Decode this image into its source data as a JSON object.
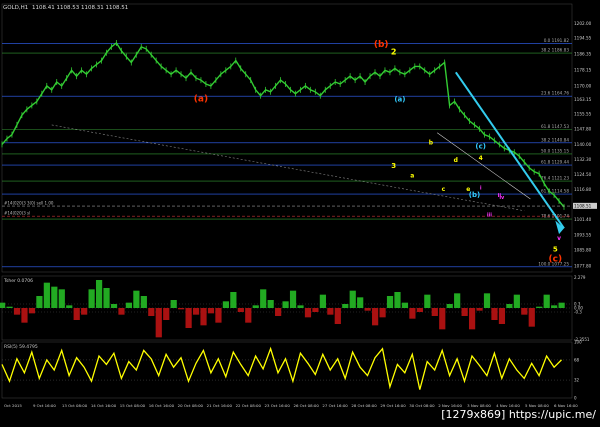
{
  "header": {
    "symbol": "GOLD,H1",
    "ohlc": "1108.41 1108.53 1108.31 1108.51"
  },
  "watermark": "[1279x869] https://upic.me/",
  "colors": {
    "background": "#000000",
    "candles": "#33cc33",
    "elliott_red": "#ff3300",
    "elliott_yellow": "#ffff00",
    "elliott_cyan": "#33ccff",
    "elliott_magenta": "#ff33ff",
    "fib_blue": "#3366ff",
    "fib_green": "#339933",
    "trend_arrow": "#33ccee",
    "osc_line": "#ffff00"
  },
  "chart_data": [
    {
      "type": "line",
      "title": "GOLD,H1 1108.41 1108.53 1108.31 1108.51",
      "ylim": [
        1074.6,
        1212.0
      ],
      "yticks": [
        1202.0,
        1194.55,
        1186.35,
        1178.15,
        1170.0,
        1163.15,
        1155.55,
        1147.8,
        1140.0,
        1132.3,
        1124.5,
        1116.8,
        1109.0,
        1101.4,
        1093.55,
        1085.8,
        1077.8
      ],
      "current_price": "1108.51",
      "x_labels": [
        "Oct 2015",
        "9 Oct 16:00",
        "13 Oct 08:00",
        "14 Oct 16:00",
        "15 Oct 08:00",
        "16 Oct 16:00",
        "20 Oct 08:00",
        "21 Oct 16:00",
        "22 Oct 08:00",
        "23 Oct 16:00",
        "26 Oct 08:00",
        "27 Oct 16:00",
        "28 Oct 08:00",
        "29 Oct 16:00",
        "30 Oct 08:00",
        "2 Nov 16:00",
        "3 Nov 08:00",
        "4 Nov 16:00",
        "5 Nov 08:00",
        "6 Nov 16:00"
      ],
      "series": [
        {
          "name": "",
          "x": [
            0,
            4,
            8,
            12,
            16,
            20,
            24,
            28,
            32,
            36,
            40,
            44,
            48,
            52,
            56,
            60,
            64,
            68,
            72,
            76,
            80,
            84,
            88,
            92,
            96,
            100,
            104,
            108,
            112,
            116,
            120,
            124,
            128,
            132,
            136,
            140,
            144,
            148,
            152,
            156,
            160,
            164,
            168,
            172,
            176,
            180,
            184,
            188,
            192,
            196,
            200,
            204,
            208,
            212,
            216,
            220,
            224,
            228,
            232,
            236,
            240,
            244,
            248,
            252,
            256,
            260,
            264,
            268,
            272,
            276,
            280,
            284,
            288,
            292,
            296,
            300,
            304,
            308,
            312,
            316,
            320,
            324,
            328,
            332,
            336,
            340,
            344,
            348,
            352,
            356,
            360,
            364,
            368,
            372,
            376,
            380,
            384,
            388,
            392,
            396,
            400,
            404,
            408,
            412,
            416,
            420,
            424,
            428,
            432,
            436,
            440,
            444,
            448,
            452
          ],
          "y": [
            1140,
            1143,
            1145,
            1150,
            1155,
            1158,
            1160,
            1162,
            1166,
            1170,
            1168,
            1172,
            1170,
            1174,
            1178,
            1175,
            1178,
            1176,
            1179,
            1181,
            1183,
            1187,
            1190,
            1192,
            1188,
            1185,
            1182,
            1186,
            1190,
            1189,
            1186,
            1183,
            1180,
            1178,
            1176,
            1178,
            1176,
            1174,
            1177,
            1174,
            1173,
            1171,
            1170,
            1173,
            1176,
            1178,
            1180,
            1183,
            1179,
            1176,
            1173,
            1168,
            1165,
            1168,
            1167,
            1170,
            1173,
            1171,
            1168,
            1166,
            1168,
            1170,
            1168,
            1167,
            1165,
            1168,
            1170,
            1172,
            1171,
            1173,
            1175,
            1173,
            1175,
            1172,
            1175,
            1177,
            1175,
            1178,
            1177,
            1179,
            1177,
            1176,
            1178,
            1180,
            1180,
            1178,
            1176,
            1178,
            1180,
            1182,
            1160,
            1162,
            1158,
            1155,
            1152,
            1150,
            1148,
            1145,
            1144,
            1142,
            1140,
            1138,
            1137,
            1136,
            1134,
            1131,
            1128,
            1126,
            1125,
            1120,
            1116,
            1114,
            1111,
            1108
          ]
        }
      ],
      "fib_levels": [
        {
          "label": "0.0 1191.82",
          "y": 1191.82
        },
        {
          "label": "38.2 1186.83",
          "y": 1186.83
        },
        {
          "label": "23.6 1164.76",
          "y": 1164.76
        },
        {
          "label": "61.8 1147.53",
          "y": 1147.53
        },
        {
          "label": "38.2 1140.84",
          "y": 1140.84
        },
        {
          "label": "50.0 1135.15",
          "y": 1135.15
        },
        {
          "label": "61.8 1129.44",
          "y": 1129.44
        },
        {
          "label": "76.4 1121.23",
          "y": 1121.23
        },
        {
          "label": "61.8 1114.58",
          "y": 1114.58
        },
        {
          "label": "78.6 1101.74",
          "y": 1101.74
        },
        {
          "label": "100.0 1077.25",
          "y": 1077.25
        }
      ],
      "hline_labels": [
        "#14(020)3 3(0) sell 1.00",
        "#14(020)3 sl"
      ],
      "wave_labels": [
        {
          "text": "(a)",
          "color": "red"
        },
        {
          "text": "(b)",
          "color": "red"
        },
        {
          "text": "(c)",
          "color": "red"
        },
        {
          "text": "2",
          "color": "yellow"
        },
        {
          "text": "3",
          "color": "yellow"
        },
        {
          "text": "4",
          "color": "yellow"
        },
        {
          "text": "5",
          "color": "yellow"
        },
        {
          "text": "(a)",
          "color": "cyan"
        },
        {
          "text": "(b)",
          "color": "cyan"
        },
        {
          "text": "(c)",
          "color": "cyan"
        },
        {
          "text": "a",
          "color": "yellow"
        },
        {
          "text": "b",
          "color": "yellow"
        },
        {
          "text": "c",
          "color": "yellow"
        },
        {
          "text": "d",
          "color": "yellow"
        },
        {
          "text": "e",
          "color": "yellow"
        },
        {
          "text": "i",
          "color": "magenta"
        },
        {
          "text": "ii",
          "color": "magenta"
        },
        {
          "text": "iii",
          "color": "magenta"
        },
        {
          "text": "iv",
          "color": "magenta"
        },
        {
          "text": "v",
          "color": "magenta"
        }
      ]
    },
    {
      "type": "area",
      "title": "Tsher 0.0706",
      "ylim": [
        -2.4,
        2.4
      ],
      "yticks": [
        "2.279",
        "0.3",
        "0.00",
        "-0.3",
        "-2.3551"
      ],
      "grid": true,
      "series": [
        {
          "name": "",
          "x": [
            0,
            6,
            12,
            18,
            24,
            30,
            36,
            42,
            48,
            54,
            60,
            66,
            72,
            78,
            84,
            90,
            96,
            102,
            108,
            114,
            120,
            126,
            132,
            138,
            144,
            150,
            156,
            162,
            168,
            174,
            180,
            186,
            192,
            198,
            204,
            210,
            216,
            222,
            228,
            234,
            240,
            246,
            252,
            258,
            264,
            270,
            276,
            282,
            288,
            294,
            300,
            306,
            312,
            318,
            324,
            330,
            336,
            342,
            348,
            354,
            360,
            366,
            372,
            378,
            384,
            390,
            396,
            402,
            408,
            414,
            420,
            426,
            432,
            438,
            444,
            450
          ],
          "values": [
            0.4,
            0.1,
            -0.5,
            -1.1,
            -0.4,
            0.9,
            1.9,
            1.6,
            1.4,
            0.2,
            -0.9,
            -0.5,
            1.4,
            2.1,
            1.5,
            0.3,
            -0.5,
            0.4,
            1.3,
            0.9,
            -0.6,
            -2.2,
            -0.9,
            0.6,
            -0.1,
            -1.5,
            -0.5,
            -1.3,
            -0.4,
            -1.1,
            0.5,
            1.2,
            -0.3,
            -1.1,
            0.2,
            1.4,
            0.6,
            -0.6,
            0.5,
            1.3,
            0.2,
            -0.7,
            -0.3,
            1.0,
            -0.5,
            -1.2,
            0.3,
            1.3,
            0.8,
            -0.2,
            -1.3,
            -0.7,
            0.9,
            1.2,
            0.4,
            -0.8,
            -0.3,
            1.0,
            -0.6,
            -1.6,
            0.3,
            1.1,
            -0.6,
            -1.6,
            -0.2,
            1.1,
            -0.9,
            -1.2,
            0.3,
            1.0,
            -0.5,
            -1.4,
            0.1,
            1.0,
            0.2,
            0.4
          ]
        }
      ]
    },
    {
      "type": "line",
      "title": "RSI(5) 59.4795",
      "ylim": [
        0,
        100
      ],
      "yticks": [
        "100",
        "68",
        "32",
        "0"
      ],
      "series": [
        {
          "name": "",
          "x": [
            0,
            6,
            12,
            18,
            24,
            30,
            36,
            42,
            48,
            54,
            60,
            66,
            72,
            78,
            84,
            90,
            96,
            102,
            108,
            114,
            120,
            126,
            132,
            138,
            144,
            150,
            156,
            162,
            168,
            174,
            180,
            186,
            192,
            198,
            204,
            210,
            216,
            222,
            228,
            234,
            240,
            246,
            252,
            258,
            264,
            270,
            276,
            282,
            288,
            294,
            300,
            306,
            312,
            318,
            324,
            330,
            336,
            342,
            348,
            354,
            360,
            366,
            372,
            378,
            384,
            390,
            396,
            402,
            408,
            414,
            420,
            426,
            432,
            438,
            444,
            450
          ],
          "values": [
            60,
            30,
            70,
            45,
            82,
            35,
            68,
            50,
            85,
            40,
            72,
            55,
            30,
            75,
            60,
            80,
            35,
            65,
            50,
            85,
            70,
            40,
            78,
            55,
            72,
            30,
            62,
            85,
            45,
            70,
            38,
            82,
            60,
            40,
            75,
            52,
            88,
            45,
            70,
            30,
            80,
            62,
            42,
            78,
            50,
            70,
            35,
            82,
            55,
            40,
            72,
            88,
            20,
            60,
            45,
            78,
            15,
            65,
            50,
            85,
            40,
            70,
            30,
            75,
            58,
            40,
            80,
            35,
            70,
            50,
            35,
            62,
            40,
            75,
            55,
            68
          ]
        }
      ]
    }
  ]
}
